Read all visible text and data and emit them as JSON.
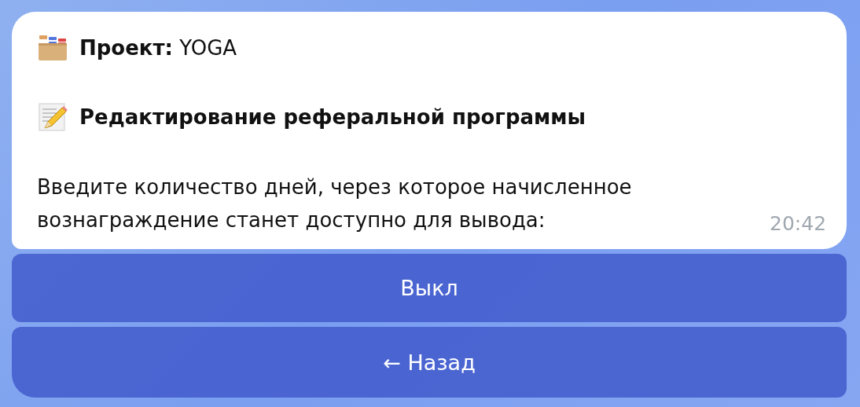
{
  "message": {
    "project": "**Проект:** YOGA",
    "heading": "Редактирование реферальной программы",
    "text": "Введите количество дней, через которое начисленное вознаграждение станет доступно для вывода:",
    "time": "20:42"
  },
  "buttons": [
    {
      "label": "Выкл"
    },
    {
      "label": "← Назад"
    }
  ]
}
